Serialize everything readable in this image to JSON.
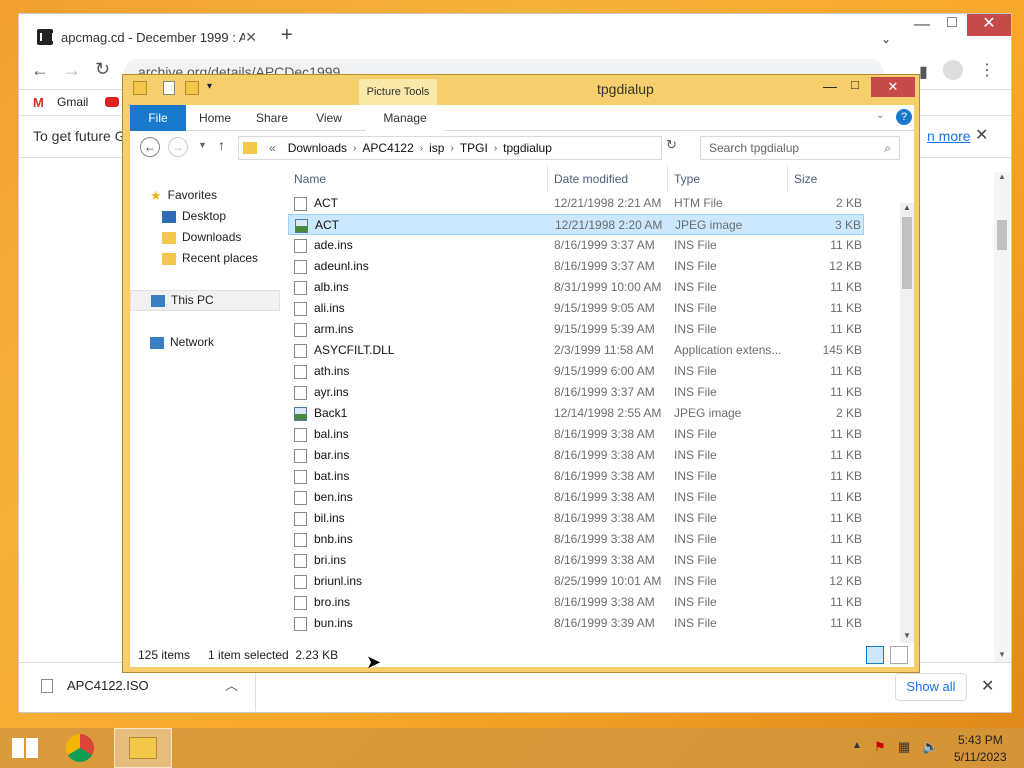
{
  "browser": {
    "tab_title": "apcmag.cd - December 1999 : A",
    "url": "archive.org/details/APCDec1999",
    "bookmarks": [
      "Gmail"
    ],
    "info_text": "To get future G",
    "info_link": "n more",
    "download_file": "APC4122.ISO",
    "show_all": "Show all"
  },
  "explorer": {
    "window_title": "tpgdialup",
    "context_tab": "Picture Tools",
    "tabs": [
      "File",
      "Home",
      "Share",
      "View",
      "Manage"
    ],
    "path": [
      "Downloads",
      "APC4122",
      "isp",
      "TPGI",
      "tpgdialup"
    ],
    "path_prefix": "«",
    "search_placeholder": "Search tpgdialup",
    "nav": {
      "favorites": "Favorites",
      "desktop": "Desktop",
      "downloads": "Downloads",
      "recent": "Recent places",
      "thispc": "This PC",
      "network": "Network"
    },
    "columns": [
      "Name",
      "Date modified",
      "Type",
      "Size"
    ],
    "files": [
      {
        "name": "ACT",
        "date": "12/21/1998 2:21 AM",
        "type": "HTM File",
        "size": "2 KB",
        "kind": "doc"
      },
      {
        "name": "ACT",
        "date": "12/21/1998 2:20 AM",
        "type": "JPEG image",
        "size": "3 KB",
        "kind": "img",
        "selected": true
      },
      {
        "name": "ade.ins",
        "date": "8/16/1999 3:37 AM",
        "type": "INS File",
        "size": "11 KB",
        "kind": "doc"
      },
      {
        "name": "adeunl.ins",
        "date": "8/16/1999 3:37 AM",
        "type": "INS File",
        "size": "12 KB",
        "kind": "doc"
      },
      {
        "name": "alb.ins",
        "date": "8/31/1999 10:00 AM",
        "type": "INS File",
        "size": "11 KB",
        "kind": "doc"
      },
      {
        "name": "ali.ins",
        "date": "9/15/1999 9:05 AM",
        "type": "INS File",
        "size": "11 KB",
        "kind": "doc"
      },
      {
        "name": "arm.ins",
        "date": "9/15/1999 5:39 AM",
        "type": "INS File",
        "size": "11 KB",
        "kind": "doc"
      },
      {
        "name": "ASYCFILT.DLL",
        "date": "2/3/1999 11:58 AM",
        "type": "Application extens...",
        "size": "145 KB",
        "kind": "dll"
      },
      {
        "name": "ath.ins",
        "date": "9/15/1999 6:00 AM",
        "type": "INS File",
        "size": "11 KB",
        "kind": "doc"
      },
      {
        "name": "ayr.ins",
        "date": "8/16/1999 3:37 AM",
        "type": "INS File",
        "size": "11 KB",
        "kind": "doc"
      },
      {
        "name": "Back1",
        "date": "12/14/1998 2:55 AM",
        "type": "JPEG image",
        "size": "2 KB",
        "kind": "img"
      },
      {
        "name": "bal.ins",
        "date": "8/16/1999 3:38 AM",
        "type": "INS File",
        "size": "11 KB",
        "kind": "doc"
      },
      {
        "name": "bar.ins",
        "date": "8/16/1999 3:38 AM",
        "type": "INS File",
        "size": "11 KB",
        "kind": "doc"
      },
      {
        "name": "bat.ins",
        "date": "8/16/1999 3:38 AM",
        "type": "INS File",
        "size": "11 KB",
        "kind": "doc"
      },
      {
        "name": "ben.ins",
        "date": "8/16/1999 3:38 AM",
        "type": "INS File",
        "size": "11 KB",
        "kind": "doc"
      },
      {
        "name": "bil.ins",
        "date": "8/16/1999 3:38 AM",
        "type": "INS File",
        "size": "11 KB",
        "kind": "doc"
      },
      {
        "name": "bnb.ins",
        "date": "8/16/1999 3:38 AM",
        "type": "INS File",
        "size": "11 KB",
        "kind": "doc"
      },
      {
        "name": "bri.ins",
        "date": "8/16/1999 3:38 AM",
        "type": "INS File",
        "size": "11 KB",
        "kind": "doc"
      },
      {
        "name": "briunl.ins",
        "date": "8/25/1999 10:01 AM",
        "type": "INS File",
        "size": "12 KB",
        "kind": "doc"
      },
      {
        "name": "bro.ins",
        "date": "8/16/1999 3:38 AM",
        "type": "INS File",
        "size": "11 KB",
        "kind": "doc"
      },
      {
        "name": "bun.ins",
        "date": "8/16/1999 3:39 AM",
        "type": "INS File",
        "size": "11 KB",
        "kind": "doc"
      }
    ],
    "status_items": "125 items",
    "status_selected": "1 item selected  2.23 KB"
  },
  "taskbar": {
    "time": "5:43 PM",
    "date": "5/11/2023"
  },
  "colors": {
    "ribbon_file": "#1979ca",
    "explorer_frame": "#f6cf6c",
    "close_red": "#c74a4a",
    "selection": "#cce8ff"
  }
}
